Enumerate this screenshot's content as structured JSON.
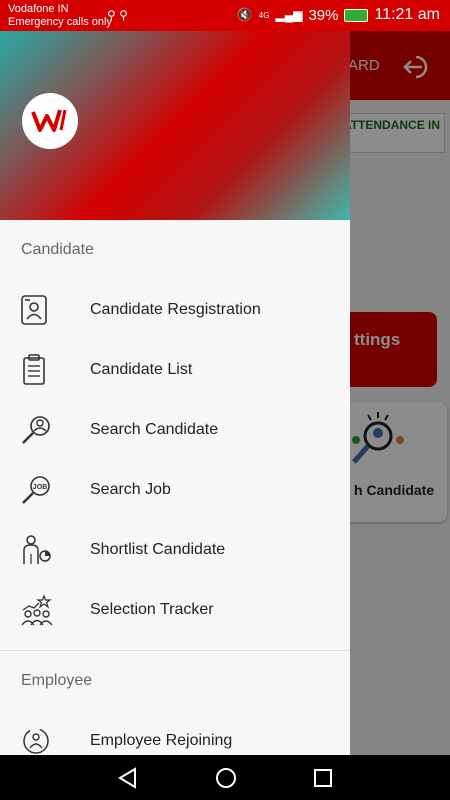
{
  "status_bar": {
    "carrier": "Vodafone IN",
    "emergency": "Emergency calls only",
    "network": "4G",
    "battery": "39%",
    "time": "11:21 am"
  },
  "background_app": {
    "title_fragment": "ARD",
    "attendance_label": "ATTENDANCE IN",
    "settings_fragment": "ttings",
    "search_candidate_fragment": "h Candidate"
  },
  "drawer": {
    "sections": [
      {
        "title": "Candidate",
        "items": [
          {
            "label": "Candidate Resgistration",
            "icon": "id-card-icon"
          },
          {
            "label": "Candidate List",
            "icon": "clipboard-list-icon"
          },
          {
            "label": "Search Candidate",
            "icon": "search-person-icon"
          },
          {
            "label": "Search Job",
            "icon": "search-job-icon"
          },
          {
            "label": "Shortlist Candidate",
            "icon": "shortlist-person-icon"
          },
          {
            "label": "Selection Tracker",
            "icon": "group-star-icon"
          }
        ]
      },
      {
        "title": "Employee",
        "items": [
          {
            "label": "Employee Rejoining",
            "icon": "rejoin-icon"
          }
        ]
      }
    ]
  },
  "colors": {
    "brand_red": "#d40000",
    "accent_teal": "#2aa9a3"
  }
}
